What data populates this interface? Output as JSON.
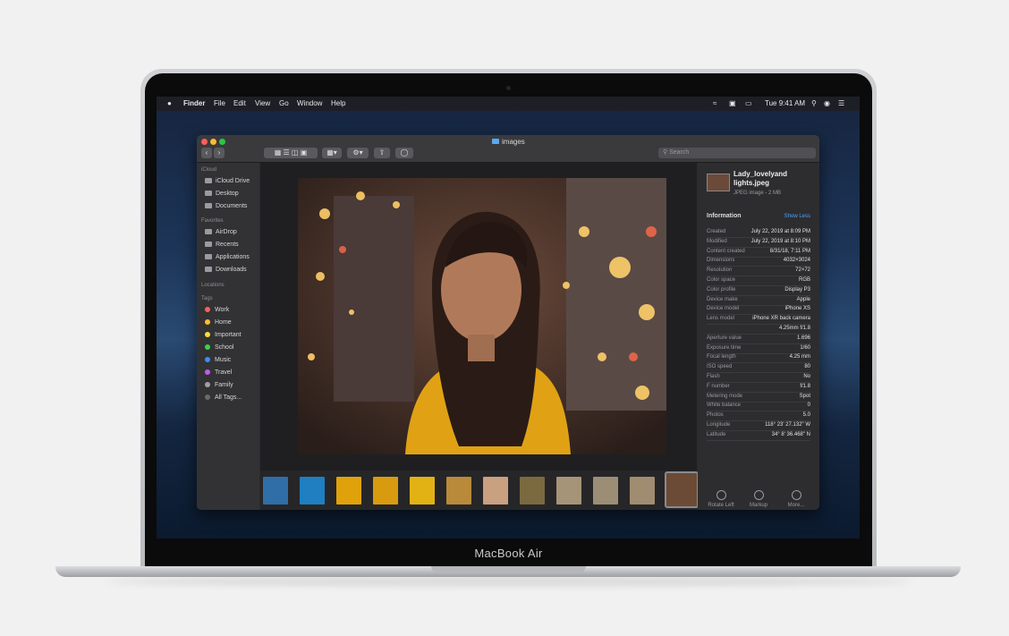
{
  "device": {
    "brand": "MacBook Air"
  },
  "menubar": {
    "apple": "",
    "app": "Finder",
    "items": [
      "File",
      "Edit",
      "View",
      "Go",
      "Window",
      "Help"
    ],
    "time": "Tue 9:41 AM"
  },
  "window": {
    "title": "images",
    "search_placeholder": "Search"
  },
  "sidebar": {
    "icloud_heading": "iCloud",
    "icloud": [
      "iCloud Drive",
      "Desktop",
      "Documents"
    ],
    "favorites_heading": "Favorites",
    "favorites": [
      "AirDrop",
      "Recents",
      "Applications",
      "Downloads"
    ],
    "locations_heading": "Locations",
    "tags_heading": "Tags",
    "tags": [
      {
        "label": "Work",
        "color": "#ff5f57"
      },
      {
        "label": "Home",
        "color": "#ffbd2e"
      },
      {
        "label": "Important",
        "color": "#f5e03a"
      },
      {
        "label": "School",
        "color": "#3ad34b"
      },
      {
        "label": "Music",
        "color": "#3a8ef5"
      },
      {
        "label": "Travel",
        "color": "#c05cf0"
      },
      {
        "label": "Family",
        "color": "#a0a0a4"
      },
      {
        "label": "All Tags...",
        "color": "#6a6a6e"
      }
    ]
  },
  "file": {
    "name_line1": "Lady_lovelyand",
    "name_line2": "lights.jpeg",
    "kind": "JPEG image - 2 MB"
  },
  "info": {
    "heading": "Information",
    "toggle": "Show Less",
    "rows": [
      {
        "k": "Created",
        "v": "July 22, 2019 at 8:09 PM"
      },
      {
        "k": "Modified",
        "v": "July 22, 2019 at 8:10 PM"
      },
      {
        "k": "Content created",
        "v": "8/31/18, 7:11 PM"
      },
      {
        "k": "Dimensions",
        "v": "4032×3024"
      },
      {
        "k": "Resolution",
        "v": "72×72"
      },
      {
        "k": "Color space",
        "v": "RGB"
      },
      {
        "k": "Color profile",
        "v": "Display P3"
      },
      {
        "k": "Device make",
        "v": "Apple"
      },
      {
        "k": "Device model",
        "v": "iPhone XS"
      },
      {
        "k": "Lens model",
        "v": "iPhone XR back camera"
      },
      {
        "k": "",
        "v": "4.25mm f/1.8"
      },
      {
        "k": "Aperture value",
        "v": "1.696"
      },
      {
        "k": "Exposure time",
        "v": "1/60"
      },
      {
        "k": "Focal length",
        "v": "4.25 mm"
      },
      {
        "k": "ISO speed",
        "v": "80"
      },
      {
        "k": "Flash",
        "v": "No"
      },
      {
        "k": "F number",
        "v": "f/1.8"
      },
      {
        "k": "Metering mode",
        "v": "Spot"
      },
      {
        "k": "White balance",
        "v": "0"
      },
      {
        "k": "Photos",
        "v": "5.0"
      },
      {
        "k": "Longitude",
        "v": "118° 23' 27.132\" W"
      },
      {
        "k": "Latitude",
        "v": "34° 8' 36.468\" N"
      }
    ]
  },
  "actions": [
    "Rotate Left",
    "Markup",
    "More..."
  ],
  "thumb_colors": [
    "#2f6ea6",
    "#1f7fc0",
    "#e0a20a",
    "#d89a0e",
    "#e2b215",
    "#b88a3a",
    "#c9a080",
    "#7b6a40",
    "#a69478",
    "#9c8d75",
    "#a08c70",
    "#6b4b35"
  ]
}
